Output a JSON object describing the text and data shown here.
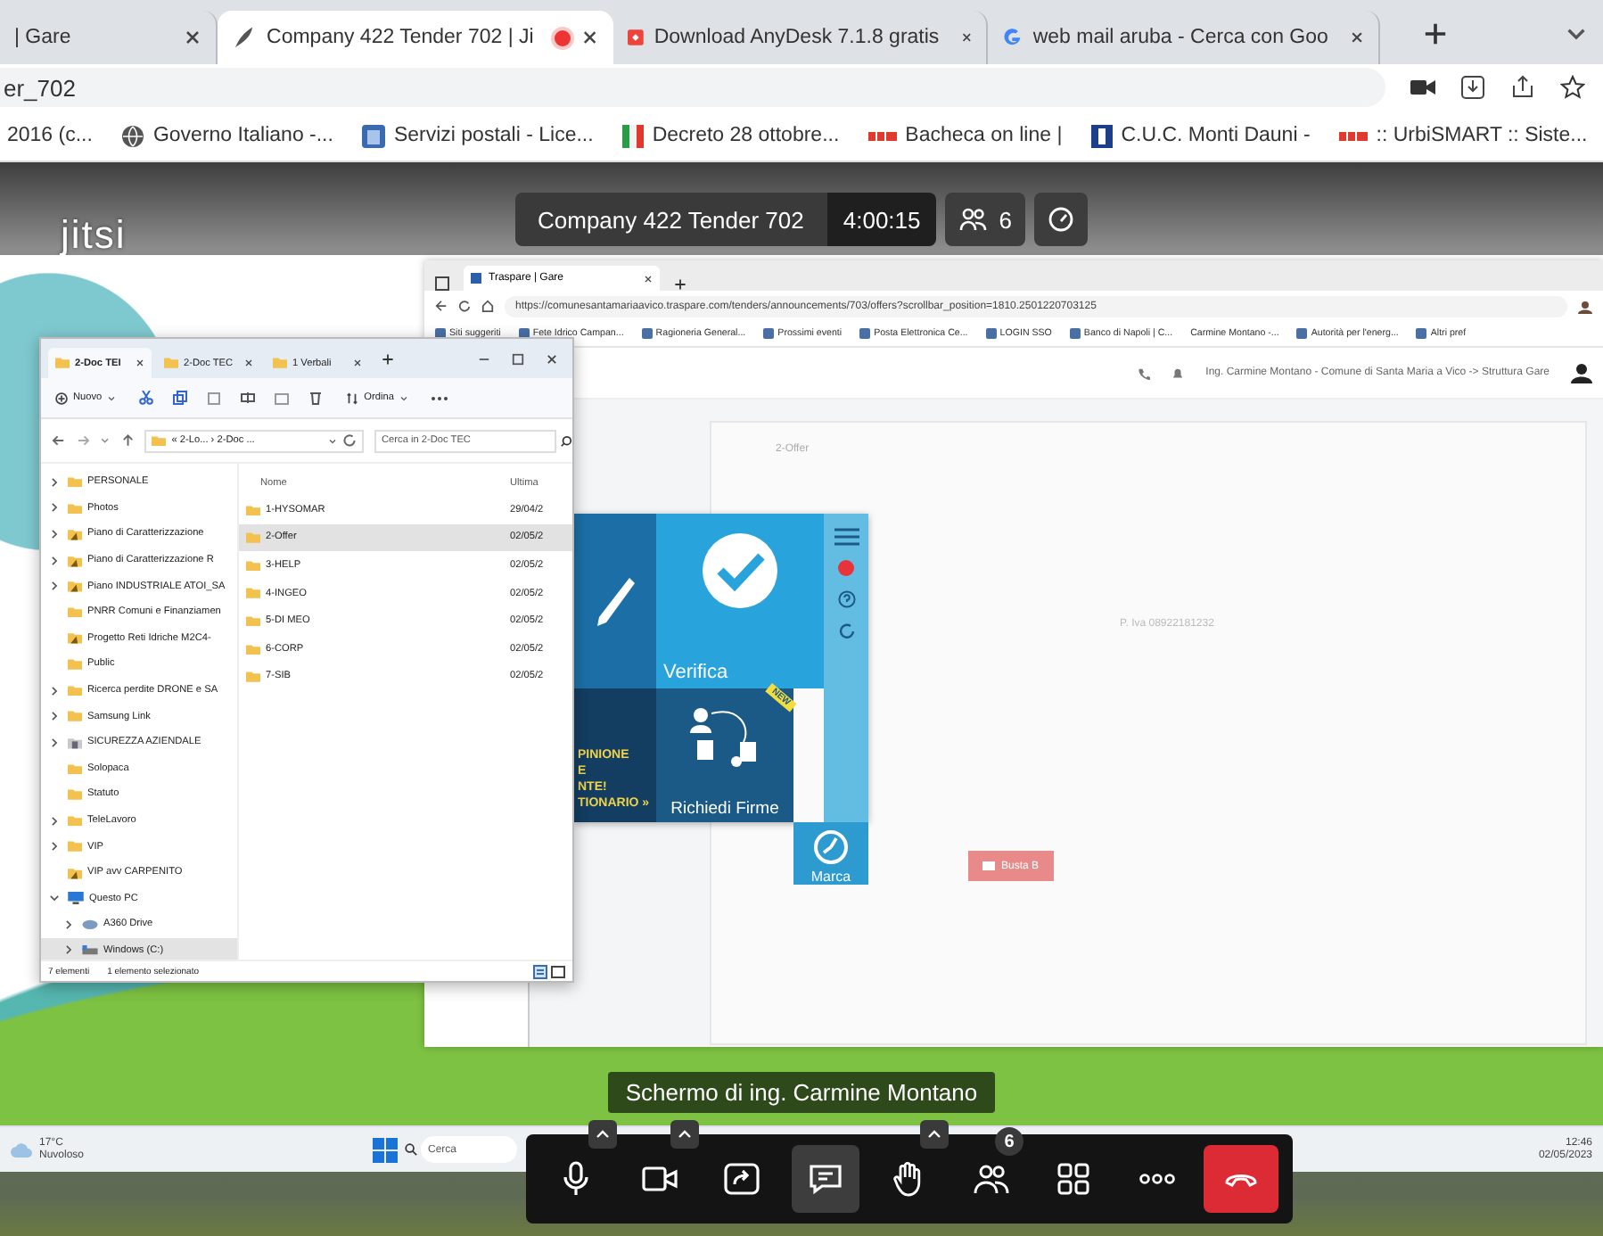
{
  "browser": {
    "tabs": [
      {
        "title": "| Gare",
        "selected": false,
        "recording": false
      },
      {
        "title": "Company 422 Tender 702 | Ji",
        "selected": true,
        "recording": true
      },
      {
        "title": "Download AnyDesk 7.1.8 gratis",
        "selected": false,
        "recording": false
      },
      {
        "title": "web mail aruba - Cerca con Goo",
        "selected": false,
        "recording": false
      }
    ],
    "address": "er_702",
    "bookmarks": [
      {
        "label": "2016 (c..."
      },
      {
        "label": "Governo Italiano -..."
      },
      {
        "label": "Servizi postali - Lice..."
      },
      {
        "label": "Decreto 28 ottobre..."
      },
      {
        "label": "Bacheca on line |"
      },
      {
        "label": "C.U.C. Monti Dauni -"
      },
      {
        "label": ":: UrbiSMART :: Siste..."
      }
    ]
  },
  "meeting": {
    "logo": "jitsi",
    "title": "Company 422 Tender 702",
    "duration": "4:00:15",
    "participants": "6"
  },
  "shared_screen": {
    "remote_browser": {
      "tab": "Traspare | Gare",
      "url": "https://comunesantamariaavico.traspare.com/tenders/announcements/703/offers?scrollbar_position=1810.2501220703125",
      "bookmarks": [
        {
          "label": "Siti suggeriti"
        },
        {
          "label": "Fete Idrico Campan..."
        },
        {
          "label": "Ragioneria General..."
        },
        {
          "label": "Prossimi eventi"
        },
        {
          "label": "Posta Elettronica Ce..."
        },
        {
          "label": "LOGIN SSO"
        },
        {
          "label": "Banco di Napoli | C..."
        },
        {
          "label": "Carmine Montano -..."
        },
        {
          "label": "Autorità per l'energ..."
        },
        {
          "label": "Altri pref"
        }
      ],
      "user": "Ing. Carmine Montano - Comune di Santa Maria a Vico -> Struttura Gare"
    },
    "explorer": {
      "tabs": [
        {
          "title": "2-Doc TEI",
          "selected": true
        },
        {
          "title": "2-Doc TEC",
          "selected": false
        },
        {
          "title": "1 Verbali",
          "selected": false
        }
      ],
      "new_button": "Nuovo",
      "sort_button": "Ordina",
      "path": "« 2-Lo... › 2-Doc ...",
      "search_placeholder": "Cerca in 2-Doc TEC",
      "sidebar": [
        {
          "name": "PERSONALE",
          "has_children": true,
          "expanded": false,
          "selected": false
        },
        {
          "name": "Photos",
          "has_children": true,
          "expanded": false,
          "selected": false
        },
        {
          "name": "Piano di Caratterizzazione",
          "has_children": true,
          "expanded": false,
          "selected": false
        },
        {
          "name": "Piano di Caratterizzazione R",
          "has_children": true,
          "expanded": false,
          "selected": false
        },
        {
          "name": "Piano INDUSTRIALE ATOI_SA",
          "has_children": true,
          "expanded": false,
          "selected": false
        },
        {
          "name": "PNRR Comuni e Finanziamen",
          "has_children": false,
          "expanded": false,
          "selected": false
        },
        {
          "name": "Progetto Reti Idriche M2C4-",
          "has_children": false,
          "expanded": false,
          "selected": false
        },
        {
          "name": "Public",
          "has_children": false,
          "expanded": false,
          "selected": false
        },
        {
          "name": "Ricerca perdite DRONE e SA",
          "has_children": true,
          "expanded": false,
          "selected": false
        },
        {
          "name": "Samsung Link",
          "has_children": true,
          "expanded": false,
          "selected": false
        },
        {
          "name": "SICUREZZA AZIENDALE",
          "has_children": true,
          "expanded": false,
          "selected": false
        },
        {
          "name": "Solopaca",
          "has_children": false,
          "expanded": false,
          "selected": false
        },
        {
          "name": "Statuto",
          "has_children": false,
          "expanded": false,
          "selected": false
        },
        {
          "name": "TeleLavoro",
          "has_children": true,
          "expanded": false,
          "selected": false
        },
        {
          "name": "VIP",
          "has_children": true,
          "expanded": false,
          "selected": false
        },
        {
          "name": "VIP avv CARPENITO",
          "has_children": false,
          "expanded": false,
          "selected": false
        },
        {
          "name": "Questo PC",
          "has_children": true,
          "expanded": true,
          "selected": false,
          "children": [
            {
              "name": "A360 Drive",
              "has_children": true,
              "expanded": false,
              "selected": false
            },
            {
              "name": "Windows (C:)",
              "has_children": true,
              "expanded": false,
              "selected": true
            }
          ]
        }
      ],
      "columns": [
        "Nome",
        "Ultima"
      ],
      "files": [
        {
          "name": "1-HYSOMAR",
          "date": "29/04/2",
          "selected": false
        },
        {
          "name": "2-Offer",
          "date": "02/05/2",
          "selected": true
        },
        {
          "name": "3-HELP",
          "date": "02/05/2",
          "selected": false
        },
        {
          "name": "4-INGEO",
          "date": "02/05/2",
          "selected": false
        },
        {
          "name": "5-DI MEO",
          "date": "02/05/2",
          "selected": false
        },
        {
          "name": "6-CORP",
          "date": "02/05/2",
          "selected": false
        },
        {
          "name": "7-SIB",
          "date": "02/05/2",
          "selected": false
        }
      ],
      "status_count": "7 elementi",
      "status_selection": "1 elemento selezionato"
    },
    "app_tile": {
      "promo": [
        "PINIONE",
        "E",
        "NTE!",
        "TIONARIO »"
      ],
      "verify": "Verifica",
      "signatures": "Richiedi Firme",
      "timestamp": "Marca",
      "ribbon": "NEW"
    },
    "ghost_window": {
      "title": "2-Offer",
      "vat": "P. Iva 08922181232",
      "button": "Busta B"
    },
    "caption": "Schermo di ing. Carmine Montano",
    "taskbar": {
      "temperature": "17°C",
      "weather": "Nuvoloso",
      "search_placeholder": "Cerca",
      "time": "12:46",
      "date": "02/05/2023"
    }
  },
  "toolbar": [
    {
      "kind": "mic",
      "menu": true,
      "selected": false
    },
    {
      "kind": "camera",
      "menu": true,
      "selected": false
    },
    {
      "kind": "share",
      "menu": false,
      "selected": false
    },
    {
      "kind": "chat",
      "menu": false,
      "selected": true
    },
    {
      "kind": "hand",
      "menu": true,
      "selected": false
    },
    {
      "kind": "participants",
      "menu": false,
      "selected": false,
      "badge": "6"
    },
    {
      "kind": "tiles",
      "menu": false,
      "selected": false
    },
    {
      "kind": "more",
      "menu": false,
      "selected": false
    },
    {
      "kind": "hangup",
      "menu": false,
      "selected": false
    }
  ]
}
